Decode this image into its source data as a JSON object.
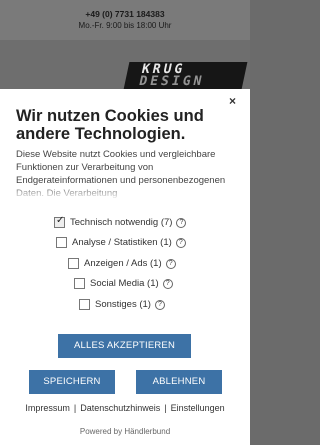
{
  "header": {
    "phone": "+49 (0) 7731 184383",
    "hours": "Mo.-Fr. 9:00 bis 18:00 Uhr"
  },
  "logo": {
    "text": "KRUG",
    "subtext": "DESIGN"
  },
  "modal": {
    "close_icon": "×",
    "title": "Wir nutzen Cookies und andere Technologien.",
    "description": "Diese Website nutzt Cookies und vergleichbare Funktionen zur Verarbeitung von Endgerateinformationen und personenbezogenen Daten. Die Verarbeitung",
    "options": [
      {
        "label": "Technisch notwendig (7)",
        "checked": true
      },
      {
        "label": "Analyse / Statistiken (1)",
        "checked": false
      },
      {
        "label": "Anzeigen / Ads (1)",
        "checked": false
      },
      {
        "label": "Social Media (1)",
        "checked": false
      },
      {
        "label": "Sonstiges (1)",
        "checked": false
      }
    ],
    "help_icon": "?",
    "accept_all": "ALLES AKZEPTIEREN",
    "save": "SPEICHERN",
    "deny": "ABLEHNEN",
    "links": [
      "Impressum",
      "Datenschutzhinweis",
      "Einstellungen"
    ],
    "link_separator": "|",
    "powered_by": "Powered by Händlerbund"
  },
  "colors": {
    "button": "#3d72a6",
    "overlay": "#6b6b6b"
  }
}
